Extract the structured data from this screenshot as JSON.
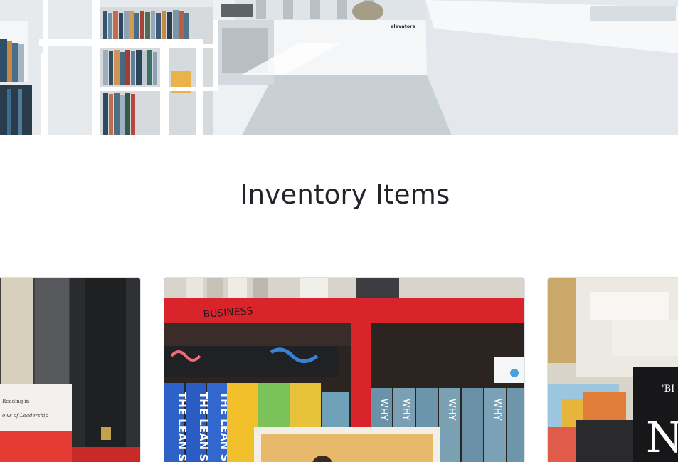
{
  "hero": {
    "image_description": "Library interior with white bookshelves and an elevator sign",
    "elevator_sign": "elevators"
  },
  "inventory": {
    "title": "Inventory Items"
  },
  "carousel": {
    "items": [
      {
        "image_description": "Dark bookshelf with a red book cover",
        "cover_lines": [
          "Reading in",
          "ows of Leadership"
        ]
      },
      {
        "image_description": "Red bookshelf with rows of books",
        "shelf_label": "BUSINESS",
        "spine_text": "THE LEAN S",
        "spine_text_2": "WHY"
      },
      {
        "image_description": "Stacked books with a black cover",
        "cover_text": "'BI"
      }
    ]
  }
}
